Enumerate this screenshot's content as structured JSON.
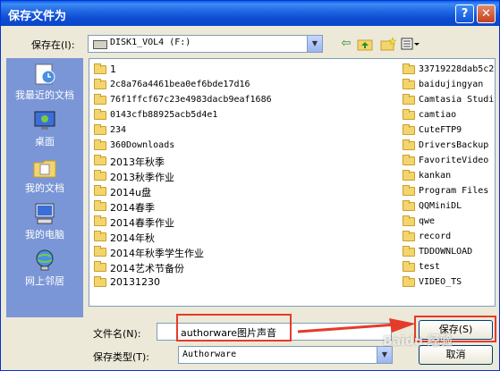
{
  "window": {
    "title": "保存文件为"
  },
  "toolbar": {
    "save_in_label": "保存在(I):",
    "location_value": "DISK1_VOL4 (F:)"
  },
  "places": [
    {
      "label": "我最近的文档",
      "icon": "recent-documents-icon"
    },
    {
      "label": "桌面",
      "icon": "desktop-icon"
    },
    {
      "label": "我的文档",
      "icon": "my-documents-icon"
    },
    {
      "label": "我的电脑",
      "icon": "my-computer-icon"
    },
    {
      "label": "网上邻居",
      "icon": "network-places-icon"
    }
  ],
  "files_col1": [
    {
      "name": "1"
    },
    {
      "name": "2c8a76a4461bea0ef6bde17d16"
    },
    {
      "name": "76f1ffcf67c23e4983dacb9eaf1686"
    },
    {
      "name": "0143cfb88925acb5d4e1"
    },
    {
      "name": "234"
    },
    {
      "name": "360Downloads"
    },
    {
      "name": "2013年秋季"
    },
    {
      "name": "2013秋季作业"
    },
    {
      "name": "2014u盘"
    },
    {
      "name": "2014春季"
    },
    {
      "name": "2014春季作业"
    },
    {
      "name": "2014年秋"
    },
    {
      "name": "2014年秋季学生作业"
    },
    {
      "name": "2014艺术节备份"
    },
    {
      "name": "20131230"
    }
  ],
  "files_col2": [
    {
      "name": "33719228dab5c2"
    },
    {
      "name": "baidujingyan"
    },
    {
      "name": "Camtasia Studi"
    },
    {
      "name": "camtiao"
    },
    {
      "name": "CuteFTP9"
    },
    {
      "name": "DriversBackup"
    },
    {
      "name": "FavoriteVideo"
    },
    {
      "name": "kankan"
    },
    {
      "name": "Program Files"
    },
    {
      "name": "QQMiniDL"
    },
    {
      "name": "qwe"
    },
    {
      "name": "record"
    },
    {
      "name": "TDDOWNLOAD"
    },
    {
      "name": "test"
    },
    {
      "name": "VIDEO_TS"
    }
  ],
  "form": {
    "filename_label": "文件名(N):",
    "filename_value": "authorware图片声音",
    "filetype_label": "保存类型(T):",
    "filetype_value": "Authorware"
  },
  "buttons": {
    "save": "保存(S)",
    "cancel": "取消"
  },
  "watermark": "Baidu 经验",
  "colors": {
    "title_bar": "#0c4cd4",
    "places_bar": "#7a96d6",
    "highlight": "#e53b2b"
  }
}
